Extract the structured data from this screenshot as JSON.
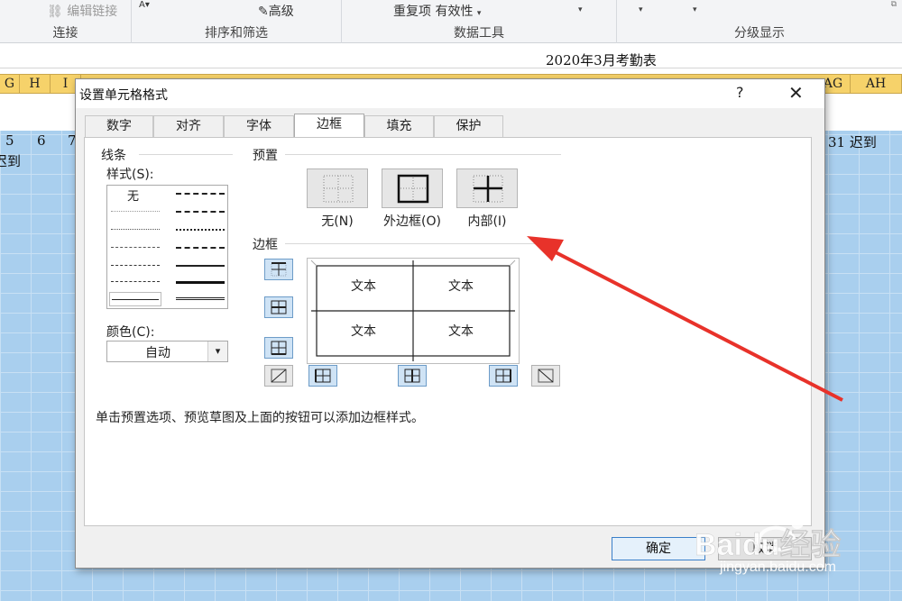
{
  "ribbon": {
    "edit_links": "编辑链接",
    "advanced": "高级",
    "dup_validity": "重复项 有效性",
    "groups": [
      "连接",
      "排序和筛选",
      "数据工具",
      "分级显示"
    ]
  },
  "sheet": {
    "title": "2020年3月考勤表",
    "columns_left": [
      "G",
      "H",
      "I"
    ],
    "columns_right": [
      "AG",
      "AH"
    ],
    "row_values": [
      "5",
      "6",
      "7"
    ],
    "right_cell": "31 迟到",
    "left_cell": "迟到"
  },
  "dialog": {
    "title": "设置单元格格式",
    "help": "?",
    "close": "✕",
    "tabs": [
      "数字",
      "对齐",
      "字体",
      "边框",
      "填充",
      "保护"
    ],
    "active_tab": "边框",
    "line_section": "线条",
    "style_label": "样式(S):",
    "style_none": "无",
    "color_label": "颜色(C):",
    "color_value": "自动",
    "presets_label": "预置",
    "presets": [
      "无(N)",
      "外边框(O)",
      "内部(I)"
    ],
    "border_label": "边框",
    "preview_text": [
      "文本",
      "文本",
      "文本",
      "文本"
    ],
    "hint": "单击预置选项、预览草图及上面的按钮可以添加边框样式。",
    "ok": "确定",
    "cancel": "取消"
  },
  "watermark": {
    "brand": "Baidu经验",
    "url": "jingyan.baidu.com"
  },
  "colors": {
    "column_header": "#f6d26a",
    "grid_fill": "#a9cfee",
    "annotation_arrow": "#e8322a",
    "selected_button": "#cfe3f5"
  }
}
